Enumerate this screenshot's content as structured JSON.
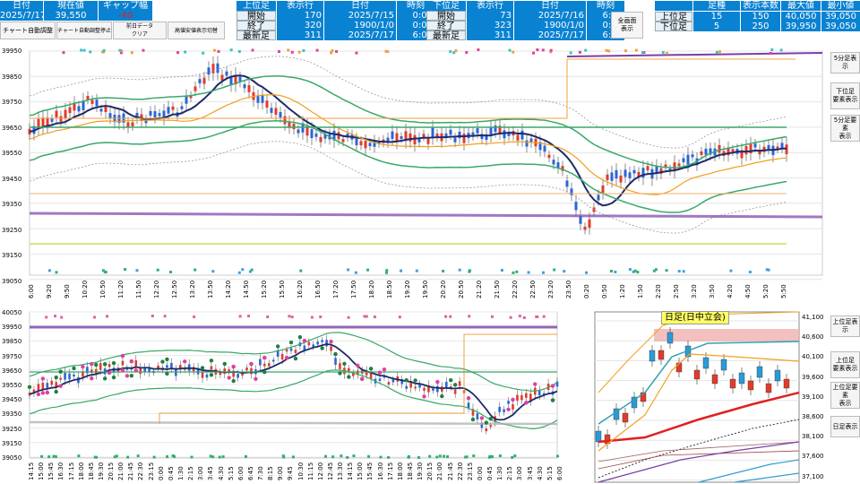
{
  "header": {
    "left_table": {
      "cols": [
        "日付",
        "現在値",
        "ギャップ幅"
      ],
      "values": [
        "2025/7/17",
        "39,550",
        "-40"
      ]
    },
    "buttons": {
      "auto_adjust": "チャート自動調整",
      "auto_adjust_stop": "チャート自動調整停止",
      "prev_day_clear": "前日データ\nクリア",
      "tick_display": "高値安値表示切替"
    },
    "upper_block": {
      "label_col": [
        "上位足",
        "開始",
        "終了",
        "最新足"
      ],
      "row_col_header": "表示行",
      "row_col": [
        "170",
        "320",
        "311"
      ],
      "date_header": "日付",
      "dates": [
        "2025/7/15",
        "1900/1/0",
        "2025/7/17"
      ],
      "time_header": "時刻",
      "times": [
        "0:00",
        "0:00",
        "6:00"
      ]
    },
    "lower_block": {
      "label_col": [
        "下位足",
        "開始",
        "終了",
        "最新足"
      ],
      "row_col_header": "表示行",
      "row_col": [
        "73",
        "323",
        "311"
      ],
      "date_header": "日付",
      "dates": [
        "2025/7/16",
        "1900/1/0",
        "2025/7/17"
      ],
      "time_header": "時刻",
      "times": [
        "6:00",
        "0:00",
        "6:00"
      ]
    },
    "fullscreen_button": "全画面\n表示",
    "summary": {
      "cols": [
        "足種",
        "表示本数",
        "最大値",
        "最小値"
      ],
      "rows": [
        {
          "label": "上位足",
          "kind": "15",
          "count": "150",
          "max": "40,050",
          "min": "39,050"
        },
        {
          "label": "下位足",
          "kind": "5",
          "count": "250",
          "max": "39,950",
          "min": "39,050"
        }
      ]
    }
  },
  "chart_top": {
    "yticks": [
      "39950",
      "39850",
      "39750",
      "39650",
      "39550",
      "39450",
      "39350",
      "39250",
      "39150",
      "39050"
    ],
    "xticks": [
      "6:00",
      "9:20",
      "9:50",
      "10:20",
      "10:50",
      "11:20",
      "11:50",
      "12:20",
      "12:50",
      "13:20",
      "13:50",
      "14:20",
      "14:50",
      "15:20",
      "15:50",
      "16:20",
      "16:50",
      "17:20",
      "17:50",
      "18:20",
      "18:50",
      "19:20",
      "19:50",
      "20:20",
      "20:50",
      "21:20",
      "21:50",
      "22:20",
      "22:50",
      "23:20",
      "23:50",
      "0:20",
      "0:50",
      "1:20",
      "1:50",
      "2:20",
      "2:50",
      "3:20",
      "3:50",
      "4:20",
      "4:50",
      "5:20",
      "5:50"
    ]
  },
  "chart_bottom": {
    "yticks": [
      "40050",
      "39950",
      "39850",
      "39750",
      "39650",
      "39550",
      "39450",
      "39350",
      "39250",
      "39150",
      "39050"
    ],
    "xticks": [
      "14:15",
      "15:00",
      "15:45",
      "16:30",
      "17:15",
      "18:00",
      "18:45",
      "19:30",
      "20:15",
      "21:00",
      "21:45",
      "22:30",
      "23:15",
      "0:00",
      "0:45",
      "1:30",
      "2:15",
      "3:00",
      "3:45",
      "4:30",
      "5:15",
      "6:00",
      "6:45",
      "7:30",
      "8:15",
      "9:00",
      "9:45",
      "10:30",
      "11:15",
      "12:00",
      "12:45",
      "13:30",
      "14:15",
      "15:00",
      "15:45",
      "16:30",
      "17:15",
      "18:00",
      "18:45",
      "19:30",
      "20:15",
      "21:00",
      "21:45",
      "22:30",
      "23:15",
      "0:00",
      "0:45",
      "1:30",
      "2:15",
      "3:00",
      "3:45",
      "4:30",
      "5:15",
      "6:00"
    ]
  },
  "chart_daily": {
    "title": "日足(日中立会)",
    "yticks": [
      "41,100",
      "40,600",
      "40,100",
      "39,600",
      "39,100",
      "38,600",
      "38,100",
      "37,600",
      "37,100"
    ]
  },
  "right_buttons": {
    "top": [
      "5分足表示",
      "下位足\n要素表示",
      "5分足要素\n表示"
    ],
    "bottom": [
      "上位足表示",
      "上位足\n要素表示",
      "上位足要素\n表示",
      "日足表示"
    ]
  },
  "colors": {
    "header_blue": "#0a82d2",
    "candle_up": "#e23b2a",
    "candle_down": "#2a66d8",
    "purple_line": "#7a3fa8",
    "green_band": "#3aa86a",
    "navy_ma": "#1e2a6a",
    "orange_ma": "#f0a020"
  }
}
